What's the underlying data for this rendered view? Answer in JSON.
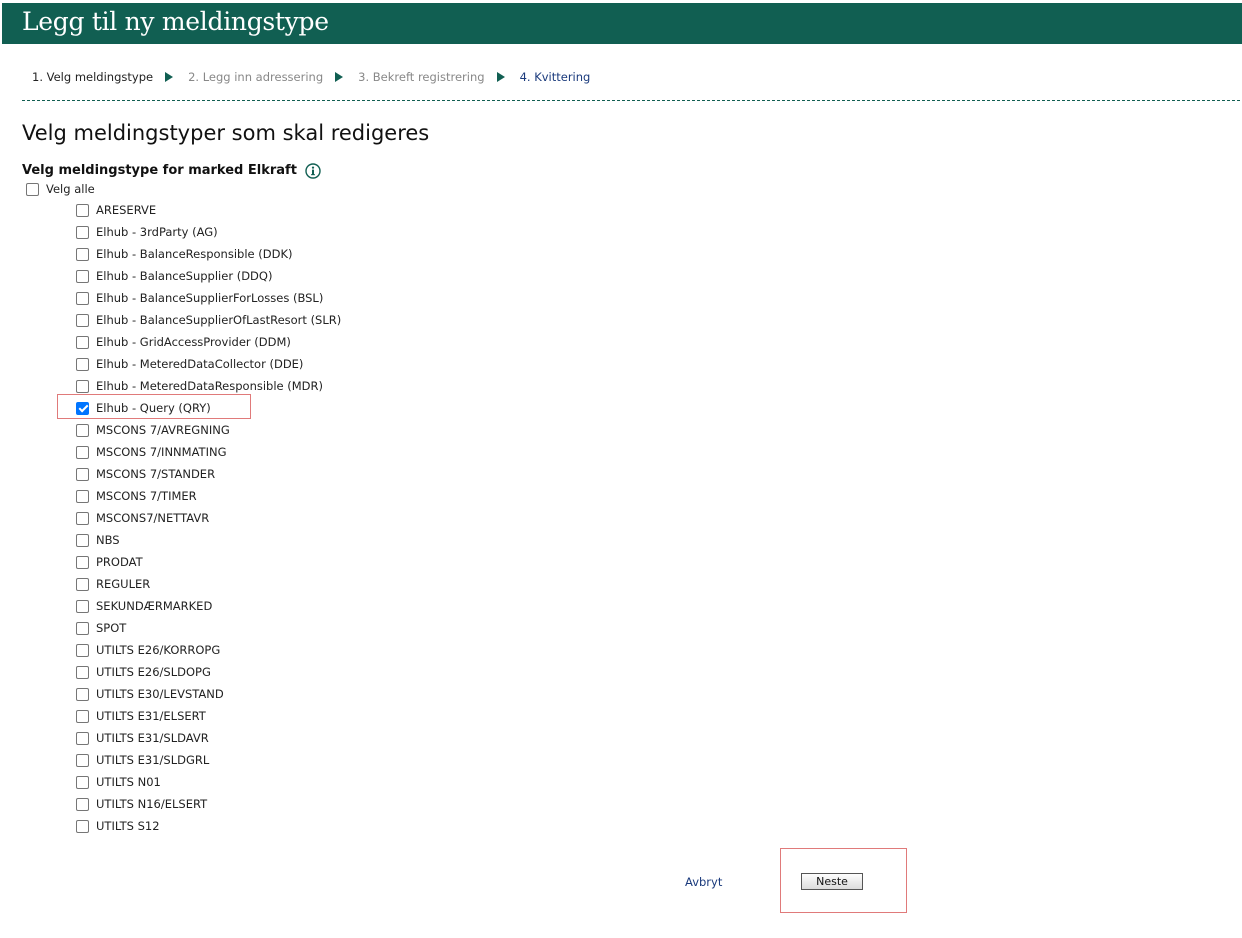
{
  "header": {
    "title": "Legg til ny meldingstype"
  },
  "steps": [
    {
      "label": "1. Velg meldingstype"
    },
    {
      "label": "2. Legg inn adressering"
    },
    {
      "label": "3. Bekreft registrering"
    },
    {
      "label": "4. Kvittering"
    }
  ],
  "page": {
    "title": "Velg meldingstyper som skal redigeres",
    "section_label": "Velg meldingstype for marked Elkraft",
    "select_all_label": "Velg alle",
    "select_all_checked": false
  },
  "message_types": [
    {
      "label": "ARESERVE",
      "checked": false
    },
    {
      "label": "Elhub - 3rdParty (AG)",
      "checked": false
    },
    {
      "label": "Elhub - BalanceResponsible (DDK)",
      "checked": false
    },
    {
      "label": "Elhub - BalanceSupplier (DDQ)",
      "checked": false
    },
    {
      "label": "Elhub - BalanceSupplierForLosses (BSL)",
      "checked": false
    },
    {
      "label": "Elhub - BalanceSupplierOfLastResort (SLR)",
      "checked": false
    },
    {
      "label": "Elhub - GridAccessProvider (DDM)",
      "checked": false
    },
    {
      "label": "Elhub - MeteredDataCollector (DDE)",
      "checked": false
    },
    {
      "label": "Elhub - MeteredDataResponsible (MDR)",
      "checked": false
    },
    {
      "label": "Elhub - Query (QRY)",
      "checked": true
    },
    {
      "label": "MSCONS 7/AVREGNING",
      "checked": false
    },
    {
      "label": "MSCONS 7/INNMATING",
      "checked": false
    },
    {
      "label": "MSCONS 7/STANDER",
      "checked": false
    },
    {
      "label": "MSCONS 7/TIMER",
      "checked": false
    },
    {
      "label": "MSCONS7/NETTAVR",
      "checked": false
    },
    {
      "label": "NBS",
      "checked": false
    },
    {
      "label": "PRODAT",
      "checked": false
    },
    {
      "label": "REGULER",
      "checked": false
    },
    {
      "label": "SEKUNDÆRMARKED",
      "checked": false
    },
    {
      "label": "SPOT",
      "checked": false
    },
    {
      "label": "UTILTS E26/KORROPG",
      "checked": false
    },
    {
      "label": "UTILTS E26/SLDOPG",
      "checked": false
    },
    {
      "label": "UTILTS E30/LEVSTAND",
      "checked": false
    },
    {
      "label": "UTILTS E31/ELSERT",
      "checked": false
    },
    {
      "label": "UTILTS E31/SLDAVR",
      "checked": false
    },
    {
      "label": "UTILTS E31/SLDGRL",
      "checked": false
    },
    {
      "label": "UTILTS N01",
      "checked": false
    },
    {
      "label": "UTILTS N16/ELSERT",
      "checked": false
    },
    {
      "label": "UTILTS S12",
      "checked": false
    }
  ],
  "actions": {
    "cancel_label": "Avbryt",
    "next_label": "Neste"
  },
  "icons": {
    "info": "info-icon",
    "step_separator": "chevron-right-icon"
  },
  "colors": {
    "header_bg": "#115f52",
    "accent": "#115f52",
    "link": "#1a3a7c",
    "checkbox_checked": "#0075ff",
    "highlight_border": "#e07a7a"
  }
}
